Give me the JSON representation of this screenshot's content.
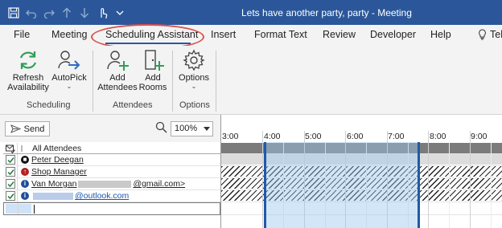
{
  "window": {
    "title": "Lets have another party, party  -  Meeting"
  },
  "quick_access": {
    "icons": [
      "save-icon",
      "undo-icon",
      "redo-icon",
      "up-arrow-icon",
      "down-arrow-icon",
      "touch-mode-icon",
      "customize-chevron-icon"
    ]
  },
  "tabs": [
    {
      "label": "File"
    },
    {
      "label": "Meeting"
    },
    {
      "label": "Scheduling Assistant",
      "active": true
    },
    {
      "label": "Insert"
    },
    {
      "label": "Format Text"
    },
    {
      "label": "Review"
    },
    {
      "label": "Developer"
    },
    {
      "label": "Help"
    },
    {
      "label": "Tell"
    }
  ],
  "ribbon": {
    "scheduling": {
      "label": "Scheduling",
      "refresh": {
        "line1": "Refresh",
        "line2": "Availability"
      },
      "autopick": {
        "label": "AutoPick"
      }
    },
    "attendees": {
      "label": "Attendees",
      "add_attendees": {
        "line1": "Add",
        "line2": "Attendees"
      },
      "add_rooms": {
        "line1": "Add",
        "line2": "Rooms"
      }
    },
    "options": {
      "label": "Options",
      "options_btn": {
        "label": "Options"
      }
    }
  },
  "toolbar": {
    "send_label": "Send",
    "zoom_value": "100%"
  },
  "attendees": {
    "header": "All Attendees",
    "rows": [
      {
        "name": "Peter Deegan",
        "role": "organizer",
        "checked": true
      },
      {
        "name": "Shop Manager",
        "role": "required-red",
        "checked": true
      },
      {
        "name_prefix": "Van Morgan",
        "name_suffix": "@gmail.com>",
        "role": "required",
        "checked": true
      },
      {
        "name_suffix": "@outlook.com",
        "role": "required",
        "checked": true
      }
    ]
  },
  "timeline": {
    "hours": [
      "3:00",
      "4:00",
      "5:00",
      "6:00",
      "7:00",
      "8:00",
      "9:00"
    ]
  },
  "colors": {
    "title_bar": "#2b579a",
    "highlight_oval": "#d9534f",
    "meeting_border": "#1f5aa6",
    "meeting_fill": "#9bc8f0",
    "busy": "#7b7b7b"
  }
}
